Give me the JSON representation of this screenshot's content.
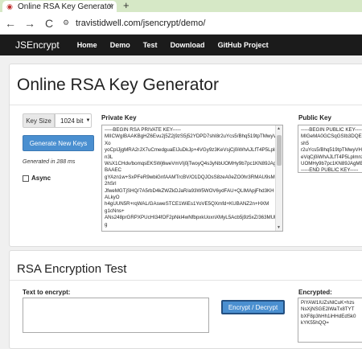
{
  "browser": {
    "tab_title": "Online RSA Key Generator",
    "tab_close": "×",
    "new_tab": "+",
    "back": "←",
    "forward": "→",
    "reload": "C",
    "url": "travistidwell.com/jsencrypt/demo/"
  },
  "navbar": {
    "brand": "JSEncrypt",
    "links": [
      "Home",
      "Demo",
      "Test",
      "Download",
      "GitHub Project"
    ]
  },
  "generator": {
    "title": "Online RSA Key Generator",
    "key_size_label": "Key Size",
    "key_size_value": "1024 bit",
    "generate_button": "Generate New Keys",
    "generated_time": "Generated in 288 ms",
    "async_label": "Async",
    "private_key_label": "Private Key",
    "private_key_text": "-----BEGIN RSA PRIVATE KEY-----\nMIICWgIBAAKBgHZ6Evu2j5Z2j9zS5j52YDPD7shI8r2uYcs5/Bhq519tpTMwyVH\nXo\nyoCpIJjgMRA2rJX7uCmedguaEIJuDkJp+4VGy9z3KeVsjCj0iWhAJLfT4P5Lplm\nn3L\nWsX1CHdv/bomqsEKSWj6weVmVIj0jTwoyQ4s3yNbUOMHy9b7pc1KN89JAgM\nBAAEC\ngYAzn1w+SxPFeR9wbiGnfAAMTrcBV/O1DQJOsS8zeA0eZO0hr3RMAU9sMg\n2hSrl\nJfweMGTjSHQ/7A5rbD4kZWZkDJaR/a93W5WOV6ydFAU+QLlMApjFhd3KH\nALkyO\nh4gUUN5R+rqWAL/GAsweSTCE1WiEs1YoVE5QXmfd+KUBANZ2n+HXM\ng1cNns+\nANs248prGRPXPUcHI34fOF2pNkI4wNfbpxkUoxnXMyL5Acb5j9z5xZ/363MUk\ng",
    "public_key_label": "Public Key",
    "public_key_text": "-----BEGIN PUBLIC KEY-----\nMIGeMA0GCSqGSIb3DQEB\nsh5\nr2uYcs5/Bhq519tpTMwyVHX\neVqCj0iWhAJLfT4P5Lplmn3\nUOMHy9b7pc1KN89JAgMB\n-----END PUBLIC KEY-----"
  },
  "encryption": {
    "title": "RSA Encryption Test",
    "input_label": "Text to encrypt:",
    "input_value": "",
    "button": "Encrypt / Decrypt",
    "output_label": "Encrypted:",
    "output_text": "PiYAW1IUZsNlCuK+hzs\nNsXjNSGE2iWaTx8TYT\nbXF8p3hHh1iHHdEdSk0\nkYK55hQQ="
  }
}
